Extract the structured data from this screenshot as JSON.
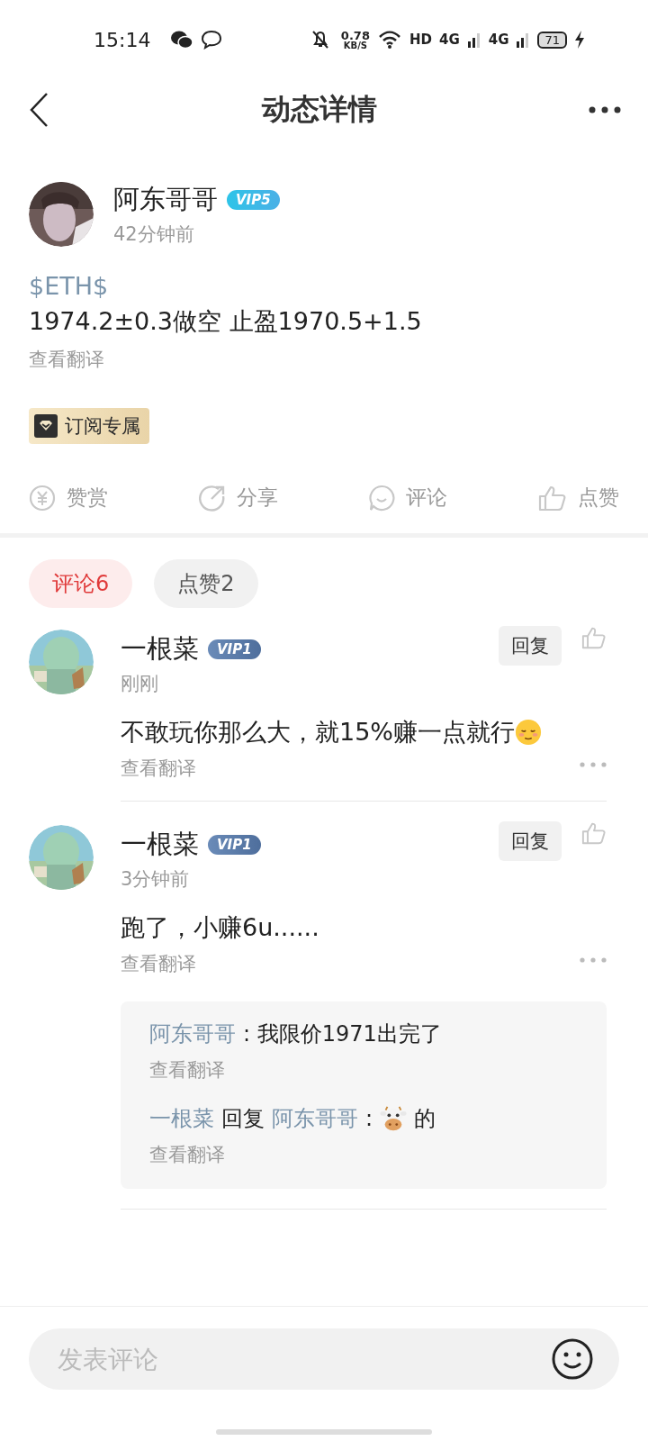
{
  "status_bar": {
    "time": "15:14",
    "speed": "0.78",
    "speed_unit": "KB/S",
    "labels": [
      "HD",
      "4G",
      "4G"
    ],
    "battery": "71"
  },
  "header": {
    "title": "动态详情"
  },
  "post": {
    "author": "阿东哥哥",
    "vip": "VIP5",
    "time": "42分钟前",
    "tag": "$ETH$",
    "text": "1974.2±0.3做空 止盈1970.5+1.5",
    "translate": "查看翻译",
    "badge": "订阅专属"
  },
  "actions": [
    {
      "kind": "reward",
      "label": "赞赏"
    },
    {
      "kind": "share",
      "label": "分享"
    },
    {
      "kind": "comment",
      "label": "评论"
    },
    {
      "kind": "like",
      "label": "点赞"
    }
  ],
  "tabs": [
    {
      "label": "评论6",
      "selected": true
    },
    {
      "label": "点赞2",
      "selected": false
    }
  ],
  "comments": [
    {
      "author": "一根菜",
      "vip": "VIP1",
      "time": "刚刚",
      "segments": [
        {
          "kind": "text",
          "text": "不敢玩你那么大，就15%赚一点就行"
        },
        {
          "kind": "face"
        }
      ],
      "translate": "查看翻译",
      "reply_button": "回复"
    },
    {
      "author": "一根菜",
      "vip": "VIP1",
      "time": "3分钟前",
      "segments": [
        {
          "kind": "text",
          "text": "跑了，小赚6u......"
        }
      ],
      "translate": "查看翻译",
      "reply_button": "回复",
      "replies": [
        {
          "segments": [
            {
              "kind": "name",
              "text": "阿东哥哥"
            },
            {
              "kind": "text",
              "text": ": 我限价1971出完了"
            }
          ],
          "translate": "查看翻译"
        },
        {
          "segments": [
            {
              "kind": "name",
              "text": "一根菜"
            },
            {
              "kind": "text",
              "text": "回复"
            },
            {
              "kind": "name",
              "text": "阿东哥哥"
            },
            {
              "kind": "text",
              "text": ":"
            },
            {
              "kind": "cow"
            },
            {
              "kind": "text",
              "text": "的"
            }
          ],
          "translate": "查看翻译"
        }
      ]
    }
  ],
  "composer": {
    "placeholder": "发表评论"
  }
}
